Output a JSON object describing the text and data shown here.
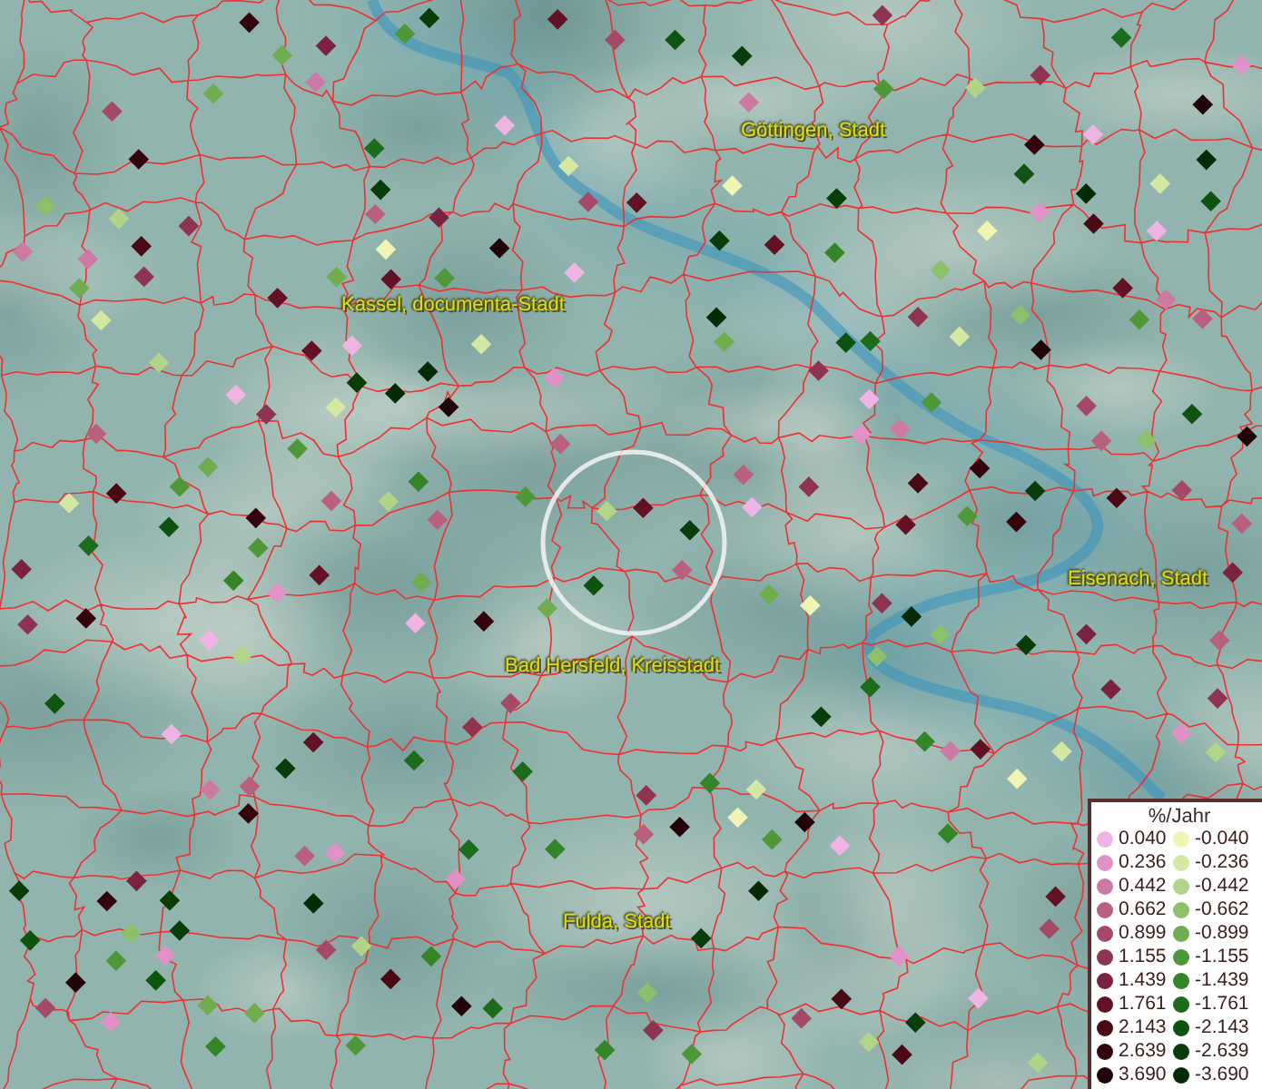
{
  "map": {
    "places": [
      {
        "name": "Göttingen, Stadt"
      },
      {
        "name": "Kassel, documenta-Stadt"
      },
      {
        "name": "Bad Hersfeld, Kreisstadt"
      },
      {
        "name": "Eisenach, Stadt"
      },
      {
        "name": "Fulda, Stadt"
      }
    ]
  },
  "legend": {
    "title": "%/Jahr",
    "positive": [
      {
        "label": "0.040",
        "color": "#f0b4e4"
      },
      {
        "label": "0.236",
        "color": "#e092c8"
      },
      {
        "label": "0.442",
        "color": "#cc7aa4"
      },
      {
        "label": "0.662",
        "color": "#b8607e"
      },
      {
        "label": "0.899",
        "color": "#a44a68"
      },
      {
        "label": "1.155",
        "color": "#8e3450"
      },
      {
        "label": "1.439",
        "color": "#7a2240"
      },
      {
        "label": "1.761",
        "color": "#621224"
      },
      {
        "label": "2.143",
        "color": "#4a0a14"
      },
      {
        "label": "2.639",
        "color": "#34040c"
      },
      {
        "label": "3.690",
        "color": "#200408"
      }
    ],
    "negative": [
      {
        "label": "-0.040",
        "color": "#f0f4b4"
      },
      {
        "label": "-0.236",
        "color": "#d4e8a4"
      },
      {
        "label": "-0.442",
        "color": "#b0d488"
      },
      {
        "label": "-0.662",
        "color": "#8cc06a"
      },
      {
        "label": "-0.899",
        "color": "#70ac50"
      },
      {
        "label": "-1.155",
        "color": "#4e983a"
      },
      {
        "label": "-1.439",
        "color": "#348428"
      },
      {
        "label": "-1.761",
        "color": "#1c6c1c"
      },
      {
        "label": "-2.143",
        "color": "#0e5410"
      },
      {
        "label": "-2.639",
        "color": "#083c08"
      },
      {
        "label": "-3.690",
        "color": "#042a06"
      }
    ]
  }
}
